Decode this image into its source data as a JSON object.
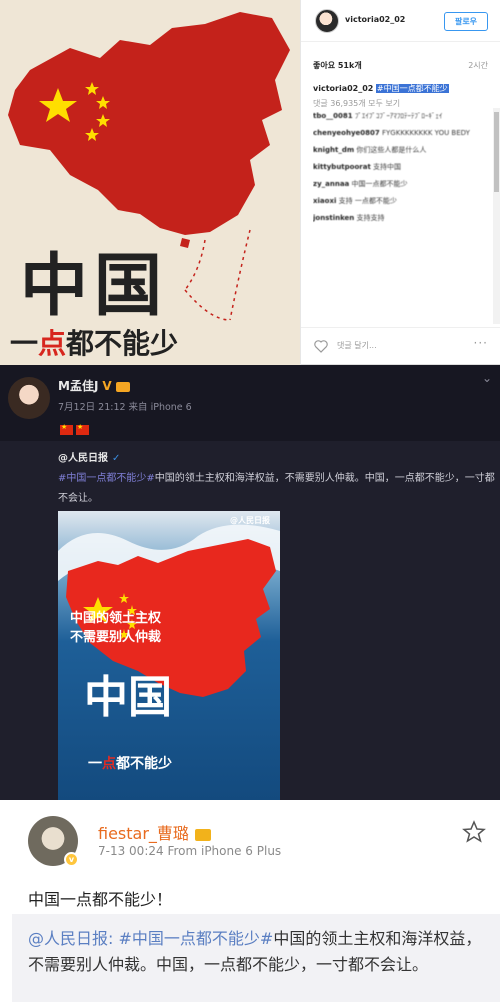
{
  "instagram": {
    "username": "victoria02_02",
    "follow_label": "팔로우",
    "likes": "좋아요 51k개",
    "time": "2시간",
    "caption_user": "victoria02_02",
    "caption_tag": "#中国一点都不能少",
    "view_comments": "댓글 36,935개 모두 보기",
    "comment_placeholder": "댓글 달기...",
    "more": "···",
    "image": {
      "title": "中国",
      "subtitle_pre": "一",
      "subtitle_red": "点",
      "subtitle_post": "都不能少"
    },
    "comments": [
      {
        "user": "tbo__0081",
        "text": "ﾌﾟｴｲﾌﾟｺﾌﾞｰｱﾏﾌﾛﾃｰﾃﾌﾞﾛｰｷﾞｪｲ"
      },
      {
        "user": "chenyeohye0807",
        "text": "FYGKKKKKKKK YOU BEDY"
      },
      {
        "user": "knight_dm",
        "text": "你们这些人都是什么人"
      },
      {
        "user": "kittybutpoorat",
        "text": "支持中国"
      },
      {
        "user": "zy_annaa",
        "text": "中国一点都不能少"
      },
      {
        "user": "xiaoxi",
        "text": "支持 一点都不能少"
      },
      {
        "user": "jonstinken",
        "text": "支持支持"
      }
    ]
  },
  "weibo_dark": {
    "name": "M孟佳J",
    "verified": "V",
    "meta": "7月12日 21:12 来自 iPhone 6",
    "repost_at": "@人民日报",
    "repost_tag": "#中国一点都不能少#",
    "repost_body": "中国的领土主权和海洋权益，不需要别人仲裁。中国，一点都不能少，一寸都不会让。",
    "chevron": "⌄",
    "image": {
      "logo": "@人民日报",
      "caption_line1": "中国的领土主权",
      "caption_line2": "不需要别人仲裁",
      "title": "中国",
      "subtitle_pre": "一",
      "subtitle_red": "点",
      "subtitle_post": "都不能少"
    }
  },
  "weibo_light": {
    "name": "fiestar_曹璐",
    "meta": "7-13 00:24   From iPhone 6 Plus",
    "text": "中国一点都不能少！",
    "repost_at": "@人民日报:",
    "repost_tag": " #中国一点都不能少#",
    "repost_body": "中国的领土主权和海洋权益，不需要别人仲裁。中国，一点都不能少，一寸都不会让。",
    "badge": "v"
  },
  "colors": {
    "china_red": "#de2910",
    "flag_yellow": "#ffde00",
    "weibo_orange": "#e86b1f",
    "link_blue": "#5b7fc2"
  }
}
